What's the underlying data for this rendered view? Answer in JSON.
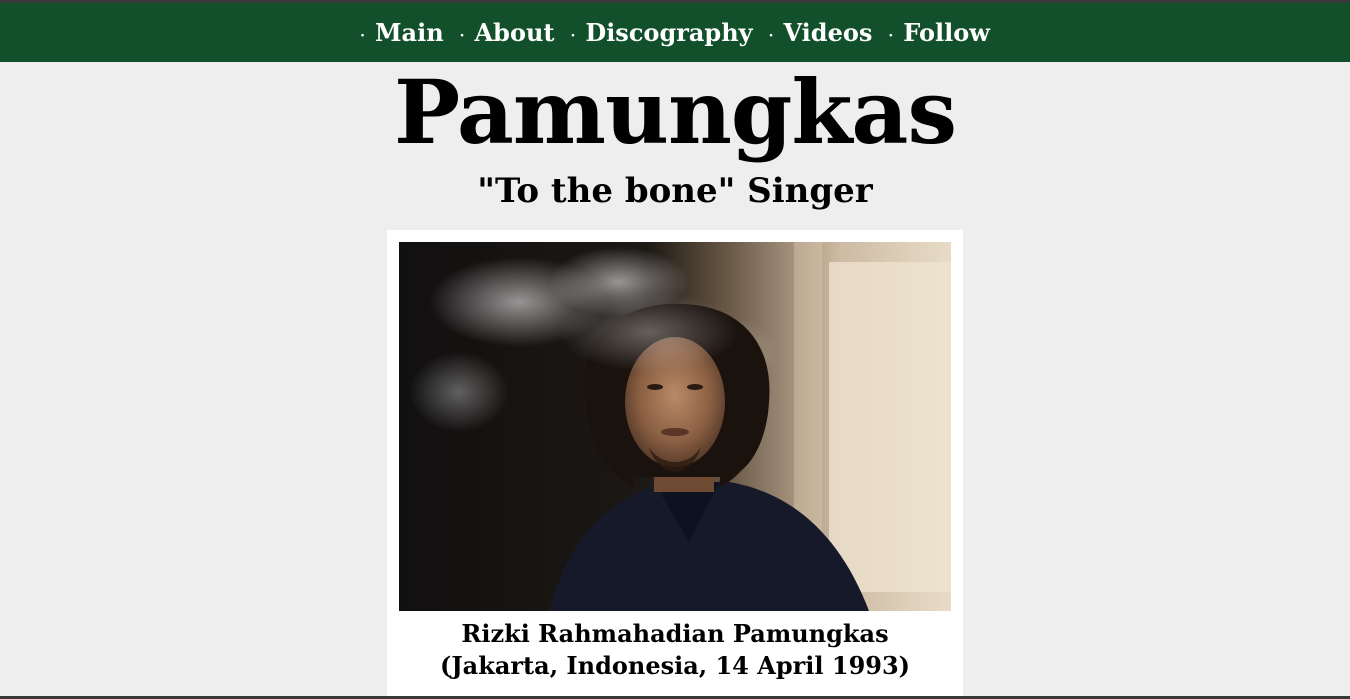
{
  "nav": {
    "bullet": "·",
    "items": [
      {
        "label": "Main"
      },
      {
        "label": "About"
      },
      {
        "label": "Discography"
      },
      {
        "label": "Videos"
      },
      {
        "label": "Follow"
      }
    ]
  },
  "header": {
    "title": "Pamungkas",
    "subtitle": "\"To the bone\" Singer"
  },
  "figure": {
    "image_alt": "Pamungkas portrait",
    "caption": "Rizki Rahmahadian Pamungkas (Jakarta, Indonesia, 14 April 1993)"
  },
  "colors": {
    "nav_bg": "#11502a",
    "page_bg": "#eeeeee",
    "card_bg": "#ffffff"
  }
}
